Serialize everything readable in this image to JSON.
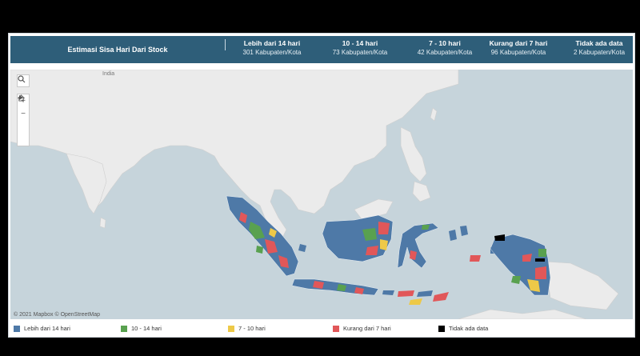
{
  "header": {
    "title": "Estimasi Sisa Hari Dari Stock",
    "categories": [
      {
        "label": "Lebih dari 14 hari",
        "count": "301 Kabupaten/Kota"
      },
      {
        "label": "10 - 14 hari",
        "count": "73 Kabupaten/Kota"
      },
      {
        "label": "7 - 10 hari",
        "count": "42 Kabupaten/Kota"
      },
      {
        "label": "Kurang dari 7 hari",
        "count": "96 Kabupaten/Kota"
      },
      {
        "label": "Tidak ada data",
        "count": "2 Kabupaten/Kota"
      }
    ]
  },
  "map": {
    "place_label": "India",
    "attribution": "© 2021 Mapbox  © OpenStreetMap",
    "controls": {
      "search_icon": "search-icon",
      "zoom_in": "+",
      "zoom_out": "−",
      "home_icon": "home-icon",
      "play_icon": "play-icon"
    }
  },
  "legend": [
    {
      "label": "Lebih dari 14 hari",
      "color": "#4e79a7"
    },
    {
      "label": "10 - 14 hari",
      "color": "#59a14f"
    },
    {
      "label": "7 - 10 hari",
      "color": "#edc948"
    },
    {
      "label": "Kurang dari 7 hari",
      "color": "#e15759"
    },
    {
      "label": "Tidak ada data",
      "color": "#000000"
    }
  ],
  "colors": {
    "header_bg": "#2e5e79",
    "sea": "#c6d4db",
    "land": "#e9e9e9"
  }
}
